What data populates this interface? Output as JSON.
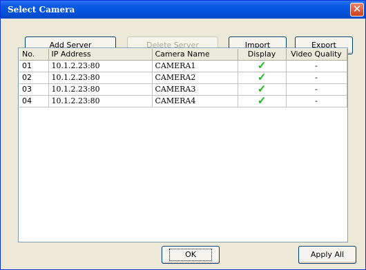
{
  "window": {
    "title": "Select Camera",
    "close_glyph": "✕"
  },
  "toolbar": {
    "add_server": "Add Server",
    "delete_server": "Delete Server",
    "import": "Import",
    "export": "Export"
  },
  "table": {
    "columns": [
      "No.",
      "IP Address",
      "Camera Name",
      "Display",
      "Video Quality"
    ],
    "rows": [
      {
        "no": "01",
        "ip": "10.1.2.23:80",
        "name": "CAMERA1",
        "display": "✓",
        "quality": "-"
      },
      {
        "no": "02",
        "ip": "10.1.2.23:80",
        "name": "CAMERA2",
        "display": "✓",
        "quality": "-"
      },
      {
        "no": "03",
        "ip": "10.1.2.23:80",
        "name": "CAMERA3",
        "display": "✓",
        "quality": "-"
      },
      {
        "no": "04",
        "ip": "10.1.2.23:80",
        "name": "CAMERA4",
        "display": "✓",
        "quality": "-"
      }
    ]
  },
  "footer": {
    "ok": "OK",
    "apply_all": "Apply All"
  },
  "colors": {
    "titlebar": "#0a59e4",
    "check": "#19b519",
    "close": "#cf3f1d"
  },
  "icons": {
    "display_check": "checkmark-icon",
    "close": "close-icon"
  }
}
